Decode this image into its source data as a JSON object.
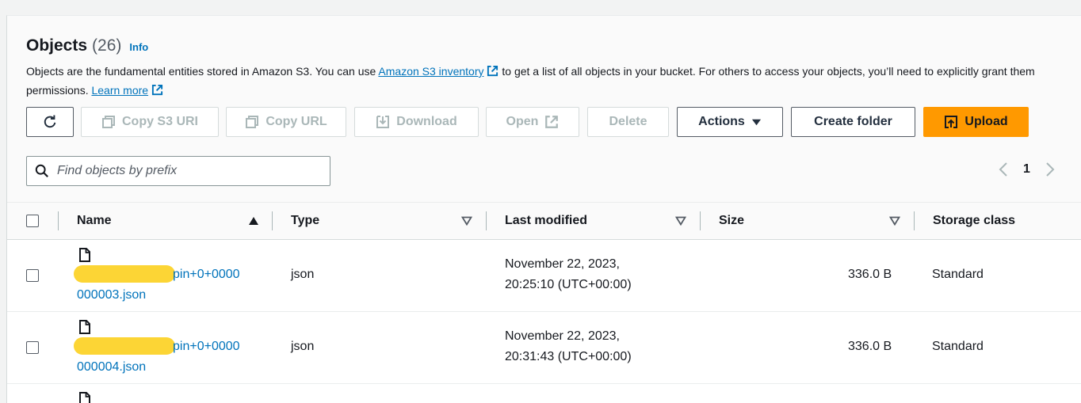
{
  "header": {
    "title": "Objects",
    "count": "(26)",
    "info": "Info",
    "desc_part1": "Objects are the fundamental entities stored in Amazon S3. You can use ",
    "desc_link": "Amazon S3 inventory",
    "desc_part2": " to get a list of all objects in your bucket. For others to access your objects, you’ll need to explicitly grant them",
    "desc_part3": "permissions. ",
    "learn_more": "Learn more"
  },
  "toolbar": {
    "copy_s3_uri": "Copy S3 URI",
    "copy_url": "Copy URL",
    "download": "Download",
    "open": "Open",
    "delete": "Delete",
    "actions": "Actions",
    "create_folder": "Create folder",
    "upload": "Upload"
  },
  "search": {
    "placeholder": "Find objects by prefix"
  },
  "pagination": {
    "current_page": "1"
  },
  "table": {
    "columns": [
      "Name",
      "Type",
      "Last modified",
      "Size",
      "Storage class"
    ],
    "rows": [
      {
        "name_line1": "pin+0+0000",
        "name_line2": "000003.json",
        "type": "json",
        "modified_line1": "November 22, 2023,",
        "modified_line2": "20:25:10 (UTC+00:00)",
        "size": "336.0 B",
        "storage_class": "Standard"
      },
      {
        "name_line1": "pin+0+0000",
        "name_line2": "000004.json",
        "type": "json",
        "modified_line1": "November 22, 2023,",
        "modified_line2": "20:31:43 (UTC+00:00)",
        "size": "336.0 B",
        "storage_class": "Standard"
      }
    ]
  },
  "colors": {
    "link": "#0073bb",
    "primary": "#ff9900",
    "redaction": "#fcd535"
  }
}
